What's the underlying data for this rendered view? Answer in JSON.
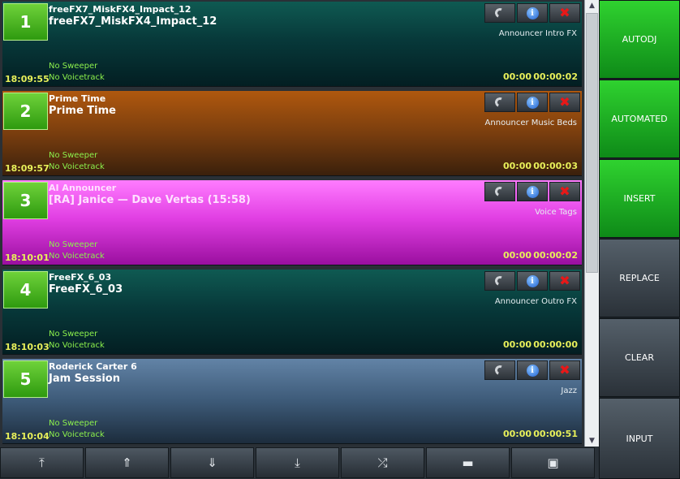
{
  "queue": [
    {
      "number": "1",
      "artist": "freeFX7_MiskFX4_Impact_12",
      "title": "freeFX7_MiskFX4_Impact_12",
      "category": "Announcer Intro FX",
      "sweeper": "No Sweeper",
      "voicetrack": "No Voicetrack",
      "start_time": "18:09:55",
      "cue": "00:00",
      "duration": "00:00:02",
      "theme": "teal"
    },
    {
      "number": "2",
      "artist": "Prime Time",
      "title": "Prime Time",
      "category": "Announcer Music Beds",
      "sweeper": "No Sweeper",
      "voicetrack": "No Voicetrack",
      "start_time": "18:09:57",
      "cue": "00:00",
      "duration": "00:00:03",
      "theme": "brown"
    },
    {
      "number": "3",
      "artist": "AI Announcer",
      "title": "[RA] Janice — Dave Vertas (15:58)",
      "category": "Voice Tags",
      "sweeper": "No Sweeper",
      "voicetrack": "No Voicetrack",
      "start_time": "18:10:01",
      "cue": "00:00",
      "duration": "00:00:02",
      "theme": "pink"
    },
    {
      "number": "4",
      "artist": "FreeFX_6_03",
      "title": "FreeFX_6_03",
      "category": "Announcer Outro FX",
      "sweeper": "No Sweeper",
      "voicetrack": "No Voicetrack",
      "start_time": "18:10:03",
      "cue": "00:00",
      "duration": "00:00:00",
      "theme": "teal"
    },
    {
      "number": "5",
      "artist": "Roderick Carter 6",
      "title": "Jam Session",
      "category": "Jazz",
      "sweeper": "No Sweeper",
      "voicetrack": "No Voicetrack",
      "start_time": "18:10:04",
      "cue": "00:00",
      "duration": "00:00:51",
      "theme": "slate"
    }
  ],
  "item_buttons": {
    "prelisten": "headphones-icon",
    "info": "info-icon",
    "remove": "close-icon",
    "info_glyph": "i",
    "remove_glyph": "✖"
  },
  "side_buttons": [
    {
      "label": "AUTODJ",
      "state": "green"
    },
    {
      "label": "AUTOMATED",
      "state": "green"
    },
    {
      "label": "INSERT",
      "state": "green"
    },
    {
      "label": "REPLACE",
      "state": "gray"
    },
    {
      "label": "CLEAR",
      "state": "gray"
    },
    {
      "label": "INPUT",
      "state": "gray"
    }
  ],
  "bottom_buttons": [
    {
      "name": "move-to-top-button",
      "glyph": "⤒",
      "icon": "move-top-icon"
    },
    {
      "name": "move-up-button",
      "glyph": "⇑",
      "icon": "move-up-icon"
    },
    {
      "name": "move-down-button",
      "glyph": "⇓",
      "icon": "move-down-icon"
    },
    {
      "name": "move-to-bottom-button",
      "glyph": "⤓",
      "icon": "move-bottom-icon"
    },
    {
      "name": "shuffle-button",
      "glyph": "⤮",
      "icon": "shuffle-icon"
    },
    {
      "name": "open-folder-button",
      "glyph": "▬",
      "icon": "folder-icon"
    },
    {
      "name": "save-button",
      "glyph": "▣",
      "icon": "save-icon"
    }
  ],
  "scrollbar": {
    "up": "▲",
    "down": "▼"
  },
  "colors": {
    "time_text": "#e8f05a",
    "sweeper_text": "#8cf04c",
    "active_green": "#18a020",
    "number_green": "#4cb626"
  }
}
